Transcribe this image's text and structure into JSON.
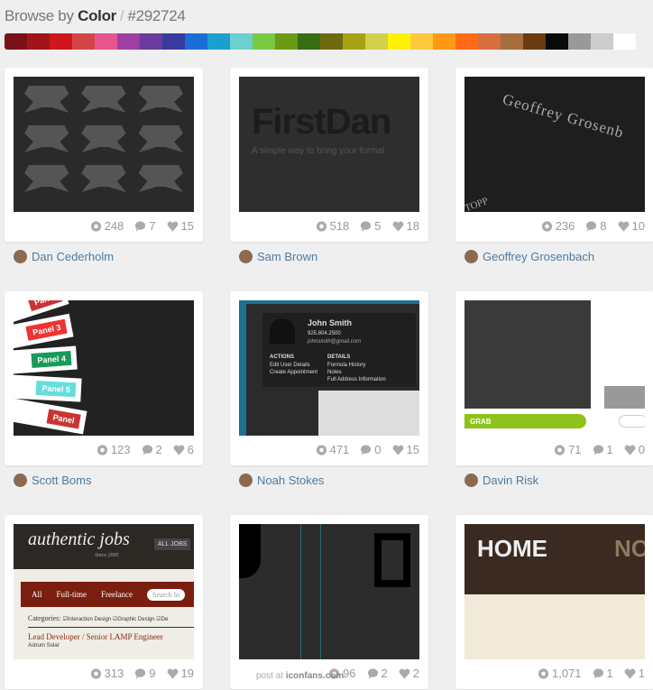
{
  "header": {
    "prefix": "Browse by",
    "bold": "Color",
    "separator": "/",
    "hex": "#292724"
  },
  "palette": [
    "#7a1116",
    "#a3141a",
    "#d0161c",
    "#d64545",
    "#e8558e",
    "#a03ea3",
    "#6b3a9e",
    "#3a3b9e",
    "#1a6ed8",
    "#1a9fd0",
    "#6ccfd0",
    "#7ac943",
    "#6b9a14",
    "#356e13",
    "#6e6a10",
    "#a5a313",
    "#d2cf4a",
    "#fff200",
    "#ffc83d",
    "#ff9914",
    "#ff6a14",
    "#d86e3e",
    "#a66d3e",
    "#6b3a10",
    "#0a0a0a",
    "#999999",
    "#cccccc",
    "#ffffff"
  ],
  "shots": [
    {
      "views": "248",
      "comments": "7",
      "likes": "15",
      "player": "Dan Cederholm",
      "thumb": {
        "kind": "pixels"
      }
    },
    {
      "views": "518",
      "comments": "5",
      "likes": "18",
      "player": "Sam Brown",
      "thumb": {
        "kind": "firstdan",
        "title": "FirstDan",
        "sub": "A simple way to bring your formal"
      }
    },
    {
      "views": "236",
      "comments": "8",
      "likes": "10",
      "player": "Geoffrey Grosenbach",
      "thumb": {
        "kind": "engrave",
        "title": "Geoffrey Grosenb",
        "sub": "TOPP"
      }
    },
    {
      "views": "123",
      "comments": "2",
      "likes": "6",
      "player": "Scott Boms",
      "thumb": {
        "kind": "panels",
        "labels": [
          "Panel",
          "Panel 3",
          "Panel 4",
          "Panel 5",
          "Panel"
        ]
      }
    },
    {
      "views": "471",
      "comments": "0",
      "likes": "15",
      "player": "Noah Stokes",
      "thumb": {
        "kind": "contact",
        "name": "John Smith",
        "phone": "925.804.2500",
        "email": "johnsmith@gmail.com",
        "h1": "ACTIONS",
        "a": [
          "Edit User Details",
          "Create Appointment"
        ],
        "h2": "DETAILS",
        "d": [
          "Formula History",
          "Notes",
          "Full Address Information"
        ]
      }
    },
    {
      "views": "71",
      "comments": "1",
      "likes": "0",
      "player": "Davin Risk",
      "thumb": {
        "kind": "grab",
        "label": "GRAB"
      }
    },
    {
      "views": "313",
      "comments": "9",
      "likes": "19",
      "player": "",
      "thumb": {
        "kind": "jobs",
        "logo": "authentic jobs",
        "since": "Since 2005",
        "btn": "ALL JOBS",
        "tabs": [
          "All",
          "Full-time",
          "Freelance"
        ],
        "search": "Search lo",
        "cats": "Categories:",
        "c": [
          "Interaction Design",
          "Graphic Design",
          "De"
        ],
        "job": "Lead Developer / Senior LAMP Engineer",
        "company": "Astrum Solar"
      }
    },
    {
      "views": "96",
      "comments": "2",
      "likes": "2",
      "player": "",
      "thumb": {
        "kind": "dark"
      }
    },
    {
      "views": "1,071",
      "comments": "1",
      "likes": "1",
      "player": "",
      "thumb": {
        "kind": "home",
        "a": "HOME",
        "b": "NO"
      }
    }
  ],
  "watermark": {
    "pre": "post at",
    "site": "iconfans.com"
  },
  "colors": {
    "link": "#4f7aa0",
    "stat": "#999999",
    "bg": "#efefef"
  }
}
